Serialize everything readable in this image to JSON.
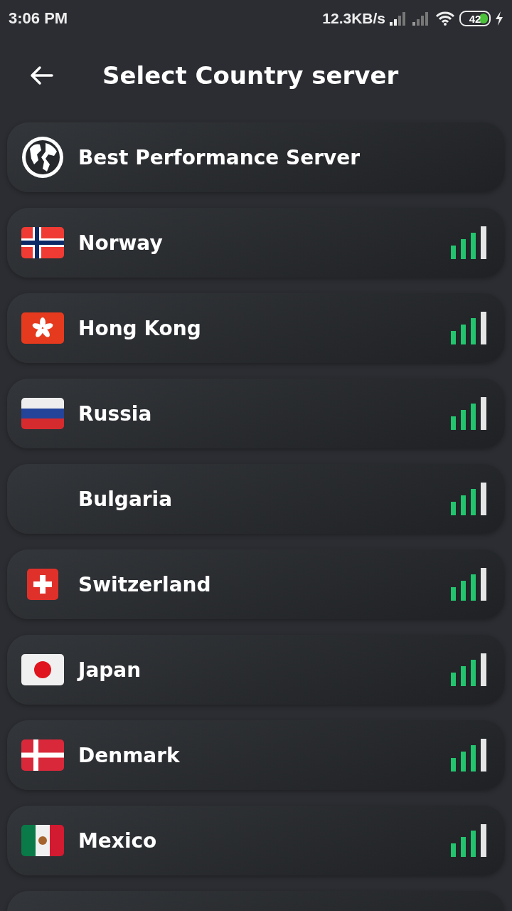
{
  "status_bar": {
    "time": "3:06 PM",
    "speed": "12.3KB/s",
    "battery": "42"
  },
  "header": {
    "title": "Select Country server"
  },
  "best": {
    "label": "Best Performance Server"
  },
  "servers": [
    {
      "name": "Norway",
      "kind": "norway"
    },
    {
      "name": "Hong Kong",
      "kind": "hongkong"
    },
    {
      "name": "Russia",
      "kind": "russia"
    },
    {
      "name": "Bulgaria",
      "kind": "blank"
    },
    {
      "name": "Switzerland",
      "kind": "switzerland"
    },
    {
      "name": "Japan",
      "kind": "japan"
    },
    {
      "name": "Denmark",
      "kind": "denmark"
    },
    {
      "name": "Mexico",
      "kind": "mexico"
    }
  ]
}
